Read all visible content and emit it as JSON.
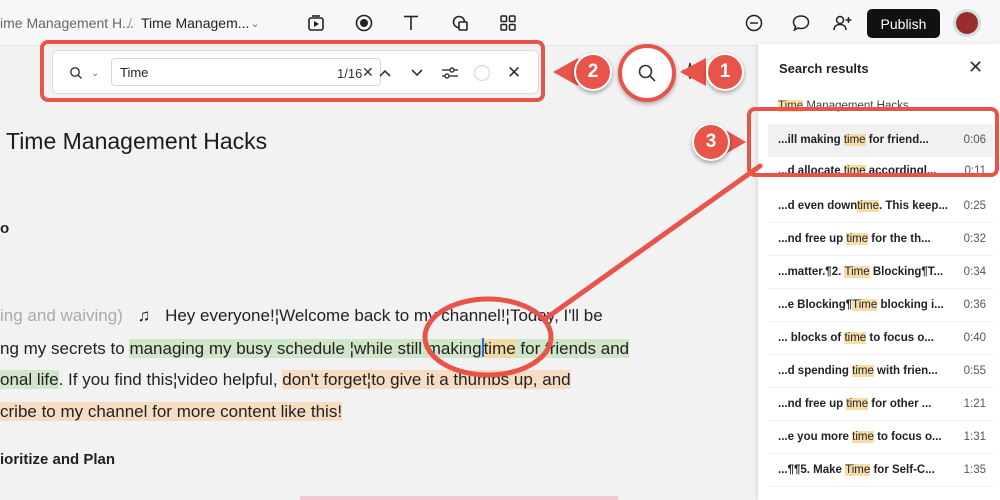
{
  "breadcrumb": {
    "project": "ime Management H...",
    "separator": "/",
    "current": "Time Managem..."
  },
  "toolbar": {
    "publish_label": "Publish"
  },
  "find": {
    "query": "Time",
    "count": "1/16"
  },
  "annotations": {
    "one": "1",
    "two": "2",
    "three": "3"
  },
  "document": {
    "title": "Time Management Hacks",
    "fragment_o": "o",
    "line1_muted": "ing and waiving)",
    "line1_note": "♫",
    "line1_text": "Hey everyone!¦Welcome back to my channel!¦Today, I'll be",
    "line2_a": "ng my secrets to ",
    "line2_b": "managing my busy schedule  ¦while still making",
    "line2_c": "time",
    "line2_d": " for friends and",
    "line3_a": "onal life",
    "line3_b": ". If you find this¦video helpful, ",
    "line3_c": "don't forget¦to give it a thumbs up, and",
    "line4_a": "cribe to my channel for more content like this!",
    "heading2": "ioritize and Plan"
  },
  "results_panel": {
    "title": "Search results",
    "items": [
      {
        "pre": "",
        "match": "Time",
        "post": " Management Hacks",
        "time": ""
      },
      {
        "pre": "...ill making ",
        "match": "time",
        "post": " for friend...",
        "time": "0:06"
      },
      {
        "pre": "...d allocate ",
        "match": "time",
        "post": " accordingl...",
        "time": "0:11"
      },
      {
        "pre": "...d even down",
        "match": "time",
        "post": ". This keep...",
        "time": "0:25"
      },
      {
        "pre": "...nd free up ",
        "match": "time",
        "post": " for the th...",
        "time": "0:32"
      },
      {
        "pre": "...matter.¶2. ",
        "match": "Time",
        "post": " Blocking¶T...",
        "time": "0:34"
      },
      {
        "pre": "...e Blocking¶",
        "match": "Time",
        "post": " blocking i...",
        "time": "0:36"
      },
      {
        "pre": "... blocks of ",
        "match": "time",
        "post": " to focus o...",
        "time": "0:40"
      },
      {
        "pre": "...d spending ",
        "match": "time",
        "post": " with frien...",
        "time": "0:55"
      },
      {
        "pre": "...nd free up ",
        "match": "time",
        "post": " for other ...",
        "time": "1:21"
      },
      {
        "pre": "...e you more ",
        "match": "time",
        "post": " to focus o...",
        "time": "1:31"
      },
      {
        "pre": "...¶¶5. Make ",
        "match": "Time",
        "post": " for Self-C...",
        "time": "1:35"
      }
    ]
  }
}
